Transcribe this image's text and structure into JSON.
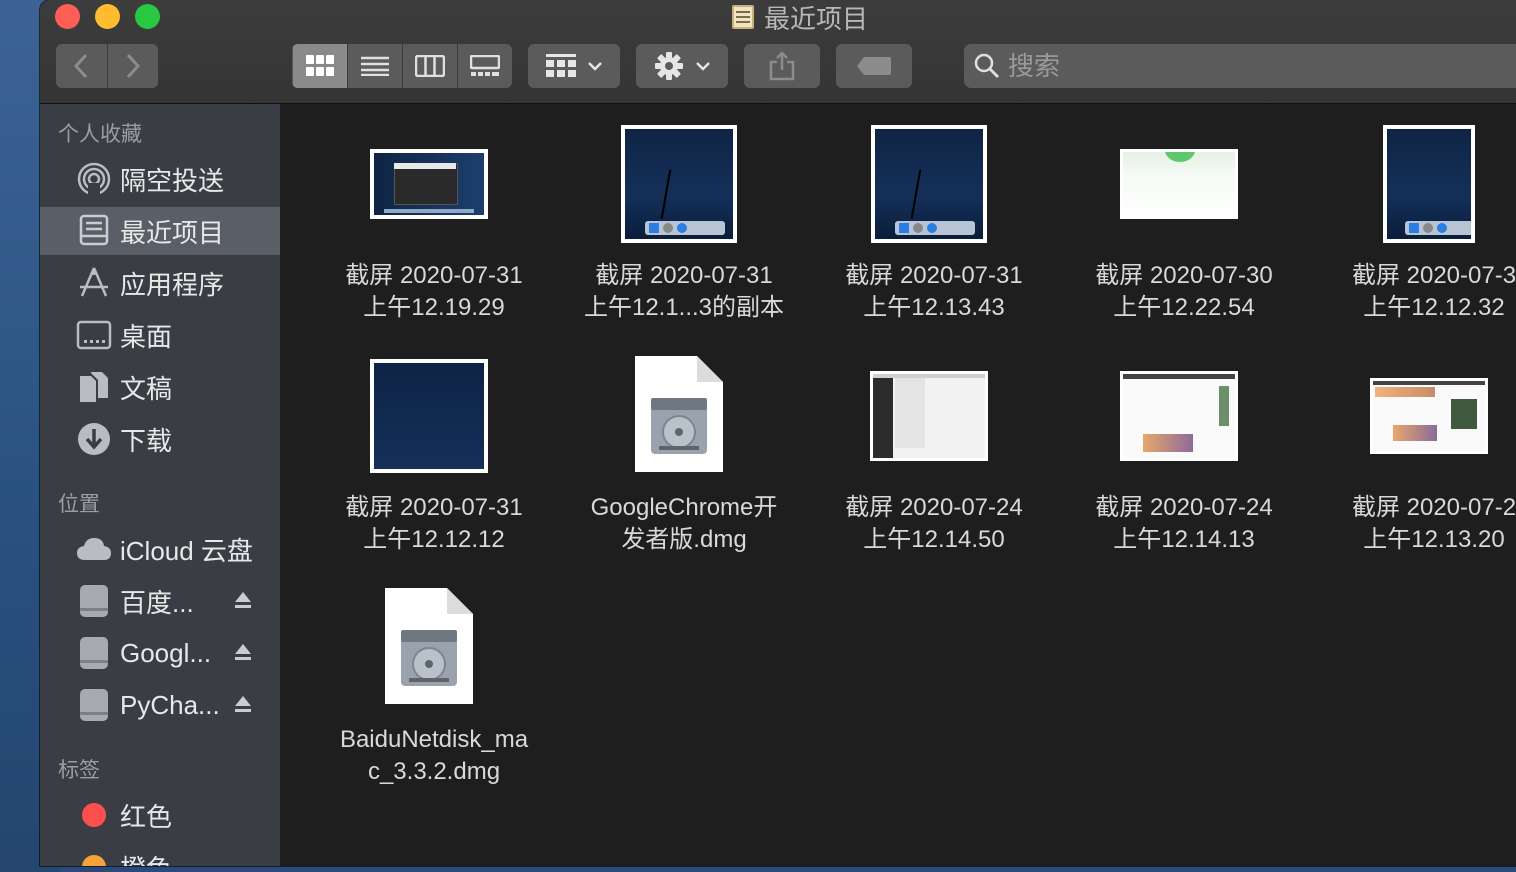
{
  "window": {
    "title": "最近项目"
  },
  "toolbar": {
    "search_placeholder": "搜索"
  },
  "sidebar": {
    "favorites_header": "个人收藏",
    "favorites": [
      {
        "label": "隔空投送",
        "icon": "airdrop-icon"
      },
      {
        "label": "最近项目",
        "icon": "recents-icon",
        "selected": true
      },
      {
        "label": "应用程序",
        "icon": "applications-icon"
      },
      {
        "label": "桌面",
        "icon": "desktop-icon"
      },
      {
        "label": "文稿",
        "icon": "documents-icon"
      },
      {
        "label": "下载",
        "icon": "downloads-icon"
      }
    ],
    "locations_header": "位置",
    "locations": [
      {
        "label": "iCloud 云盘",
        "icon": "icloud-icon"
      },
      {
        "label": "百度...",
        "icon": "disk-icon",
        "ejectable": true
      },
      {
        "label": "Googl...",
        "icon": "disk-icon",
        "ejectable": true
      },
      {
        "label": "PyCha...",
        "icon": "disk-icon",
        "ejectable": true
      }
    ],
    "tags_header": "标签",
    "tags": [
      {
        "label": "红色",
        "color": "#fd4f4d"
      },
      {
        "label": "橙色",
        "color": "#f7a23a"
      }
    ]
  },
  "files": [
    {
      "line1": "截屏 2020-07-31",
      "line2": "上午12.19.29"
    },
    {
      "line1": "截屏 2020-07-31",
      "line2": "上午12.1...3的副本"
    },
    {
      "line1": "截屏 2020-07-31",
      "line2": "上午12.13.43"
    },
    {
      "line1": "截屏 2020-07-30",
      "line2": "上午12.22.54"
    },
    {
      "line1": "截屏 2020-07-3",
      "line2": "上午12.12.32"
    },
    {
      "line1": "截屏 2020-07-31",
      "line2": "上午12.12.12"
    },
    {
      "line1": "GoogleChrome开",
      "line2": "发者版.dmg"
    },
    {
      "line1": "截屏 2020-07-24",
      "line2": "上午12.14.50"
    },
    {
      "line1": "截屏 2020-07-24",
      "line2": "上午12.14.13"
    },
    {
      "line1": "截屏 2020-07-2",
      "line2": "上午12.13.20"
    },
    {
      "line1": "BaiduNetdisk_ma",
      "line2": "c_3.3.2.dmg"
    }
  ]
}
